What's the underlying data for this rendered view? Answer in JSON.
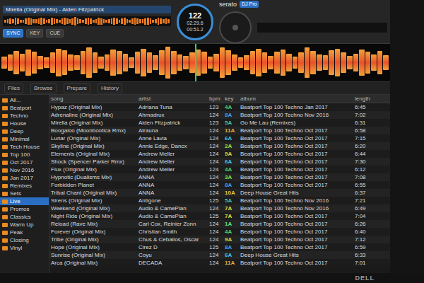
{
  "app": {
    "logo": "serato",
    "product": "DJ Pro"
  },
  "deck_left": {
    "title": "Mirella (Original Mix) - Aiden Fitzpatrick",
    "bpm": "122",
    "time_elapsed": "02:29.6",
    "time_remaining": "00:51.2",
    "buttons": [
      {
        "label": "SYNC",
        "on": true
      },
      {
        "label": "KEY",
        "on": false
      },
      {
        "label": "CUE",
        "on": false
      }
    ]
  },
  "waveform": {
    "levels": [
      0.35,
      0.5,
      0.7,
      0.55,
      0.8,
      0.65,
      0.4,
      0.3,
      0.6,
      0.85,
      0.75,
      0.5,
      0.45,
      0.7,
      0.9,
      0.6,
      0.35,
      0.5,
      0.8,
      0.7,
      0.55,
      0.3,
      0.65,
      0.85,
      0.6,
      0.45,
      0.75,
      0.95,
      0.7,
      0.5,
      0.4,
      0.6,
      0.8,
      0.65,
      0.35,
      0.55,
      0.9,
      0.75,
      0.5,
      0.3,
      0.45,
      0.7,
      0.85,
      0.6,
      0.4,
      0.65,
      0.8,
      0.55,
      0.35,
      0.6,
      0.9,
      0.7,
      0.5,
      0.45,
      0.75,
      0.85,
      0.6,
      0.4,
      0.55,
      0.8,
      0.65,
      0.5,
      0.7,
      0.45
    ]
  },
  "toolbar": {
    "tabs": [
      "Files",
      "Browse",
      "Prepare",
      "History"
    ]
  },
  "sidebar": {
    "items": [
      {
        "label": "All...",
        "selected": false
      },
      {
        "label": "Beatport",
        "selected": false
      },
      {
        "label": "Techno",
        "selected": false
      },
      {
        "label": "House",
        "selected": false
      },
      {
        "label": "Deep",
        "selected": false
      },
      {
        "label": "Minimal",
        "selected": false
      },
      {
        "label": "Tech House",
        "selected": false
      },
      {
        "label": "Top 100",
        "selected": false
      },
      {
        "label": "Oct 2017",
        "selected": false
      },
      {
        "label": "Nov 2016",
        "selected": false
      },
      {
        "label": "Jan 2017",
        "selected": false
      },
      {
        "label": "Remixes",
        "selected": false
      },
      {
        "label": "Sets",
        "selected": false
      },
      {
        "label": "Live",
        "selected": true
      },
      {
        "label": "Promos",
        "selected": false
      },
      {
        "label": "Classics",
        "selected": false
      },
      {
        "label": "Warm Up",
        "selected": false
      },
      {
        "label": "Peak",
        "selected": false
      },
      {
        "label": "Closing",
        "selected": false
      },
      {
        "label": "Vinyl",
        "selected": false
      }
    ]
  },
  "table": {
    "columns": [
      "song",
      "artist",
      "bpm",
      "key",
      "album",
      "length"
    ],
    "rows": [
      {
        "cells": [
          "Hypaz (Original Mix)",
          "Adriana Tuna",
          "123",
          "4A",
          "Beatport Top 100 Techno Jan 2017",
          "6:45"
        ],
        "color": "#4fd16b"
      },
      {
        "cells": [
          "Adrenaline (Original Mix)",
          "Ahmadrux",
          "124",
          "8A",
          "Beatport Top 100 Techno Nov 2016",
          "7:02"
        ],
        "color": "#3fa0e0"
      },
      {
        "cells": [
          "Mirella (Original Mix)",
          "Aiden Fitzpatrick",
          "123",
          "5A",
          "Go Me Lau (Remixes)",
          "6:31"
        ],
        "color": "#4cc3a0"
      },
      {
        "cells": [
          "Boogaloo (Moonbootica Rmx)",
          "Alrauna",
          "124",
          "11A",
          "Beatport Top 100 Techno Oct 2017",
          "6:58"
        ],
        "color": "#e0b03f"
      },
      {
        "cells": [
          "Lunar (Original Mix)",
          "Anne Lavia",
          "124",
          "6A",
          "Beatport Top 100 Techno Oct 2017",
          "7:15"
        ],
        "color": "#3fc6e0"
      },
      {
        "cells": [
          "Skyline (Original Mix)",
          "Annie Edge, Dancx",
          "124",
          "2A",
          "Beatport Top 100 Techno Oct 2017",
          "6:20"
        ],
        "color": "#9fe03f"
      },
      {
        "cells": [
          "Elements (Original Mix)",
          "Andrew Meller",
          "124",
          "9A",
          "Beatport Top 100 Techno Oct 2017",
          "6:44"
        ],
        "color": "#e0d23f"
      },
      {
        "cells": [
          "Shock (Spencer Parker Rmx)",
          "Andrew Meller",
          "124",
          "6A",
          "Beatport Top 100 Techno Oct 2017",
          "7:30"
        ],
        "color": "#3fc6e0"
      },
      {
        "cells": [
          "Flux (Original Mix)",
          "Andrew Meller",
          "124",
          "4A",
          "Beatport Top 100 Techno Oct 2017",
          "6:12"
        ],
        "color": "#4fd16b"
      },
      {
        "cells": [
          "Hypnotic (Dualisms Mix)",
          "ANNA",
          "124",
          "3A",
          "Beatport Top 100 Techno Oct 2017",
          "7:08"
        ],
        "color": "#7fe03f"
      },
      {
        "cells": [
          "Forbidden Planet",
          "ANNA",
          "124",
          "8A",
          "Beatport Top 100 Techno Oct 2017",
          "6:55"
        ],
        "color": "#3fa0e0"
      },
      {
        "cells": [
          "Tribal Chant (Original Mix)",
          "ANNA",
          "124",
          "10A",
          "Deep House Great Hits",
          "6:37"
        ],
        "color": "#e0c83f"
      },
      {
        "cells": [
          "Sirens (Original Mix)",
          "Antigone",
          "125",
          "5A",
          "Beatport Top 100 Techno Nov 2016",
          "7:21"
        ],
        "color": "#4cc3a0"
      },
      {
        "cells": [
          "Weekend (Original Mix)",
          "Audio & CamePlan",
          "124",
          "7A",
          "Beatport Top 100 Techno Nov 2016",
          "6:49"
        ],
        "color": "#e0e03f"
      },
      {
        "cells": [
          "Night Ride (Original Mix)",
          "Audio & CamePlan",
          "125",
          "7A",
          "Beatport Top 100 Techno Oct 2017",
          "7:04"
        ],
        "color": "#e0e03f"
      },
      {
        "cells": [
          "Reload (Rave Mix)",
          "Carl Cox, Reinier Zonn",
          "124",
          "1A",
          "Beatport Top 100 Techno Oct 2017",
          "6:26"
        ],
        "color": "#5fe07f"
      },
      {
        "cells": [
          "Forever (Original Mix)",
          "Christian Smith",
          "124",
          "4A",
          "Beatport Top 100 Techno Oct 2017",
          "6:40"
        ],
        "color": "#4fd16b"
      },
      {
        "cells": [
          "Tribe (Original Mix)",
          "Chus & Ceballos, Oscar",
          "124",
          "9A",
          "Beatport Top 100 Techno Oct 2017",
          "7:12"
        ],
        "color": "#e0d23f"
      },
      {
        "cells": [
          "Hope (Original Mix)",
          "Cirez D",
          "125",
          "8A",
          "Beatport Top 100 Techno Oct 2017",
          "6:59"
        ],
        "color": "#3fa0e0"
      },
      {
        "cells": [
          "Sunrise (Original Mix)",
          "Coyu",
          "124",
          "6A",
          "Deep House Great Hits",
          "6:33"
        ],
        "color": "#3fc6e0"
      },
      {
        "cells": [
          "Arca (Original Mix)",
          "DECADA",
          "124",
          "11A",
          "Beatport Top 100 Techno Oct 2017",
          "7:01"
        ],
        "color": "#e0b03f"
      }
    ]
  },
  "bezel": {
    "logo": "DELL"
  }
}
